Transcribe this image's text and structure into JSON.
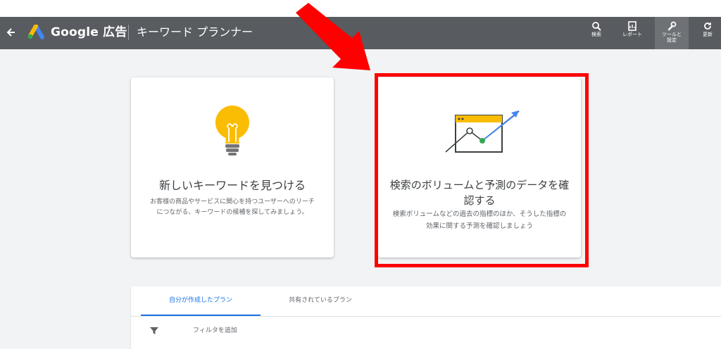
{
  "header": {
    "brand": "Google 広告",
    "page_title": "キーワード プランナー",
    "tools": [
      {
        "label": "検索",
        "icon": "search-icon"
      },
      {
        "label": "レポート",
        "icon": "report-icon"
      },
      {
        "label": "ツールと設定",
        "icon": "wrench-icon"
      },
      {
        "label": "更新",
        "icon": "refresh-icon"
      }
    ]
  },
  "cards": [
    {
      "title": "新しいキーワードを見つける",
      "description": "お客様の商品やサービスに関心を持つユーザーへのリーチにつながる、キーワードの候補を探してみましょう。",
      "icon": "lightbulb-icon"
    },
    {
      "title": "検索のボリュームと予測のデータを確認する",
      "description": "検索ボリュームなどの過去の指標のほか、そうした指標の効果に関する予測を確認しましょう",
      "icon": "trend-chart-icon"
    }
  ],
  "plans": {
    "tabs": [
      "自分が作成したプラン",
      "共有されているプラン"
    ],
    "filter_label": "フィルタを追加"
  },
  "colors": {
    "topbar": "#585b5f",
    "accent": "#1a73e8",
    "highlight": "#ff0000",
    "bulb": "#fbbc04"
  }
}
